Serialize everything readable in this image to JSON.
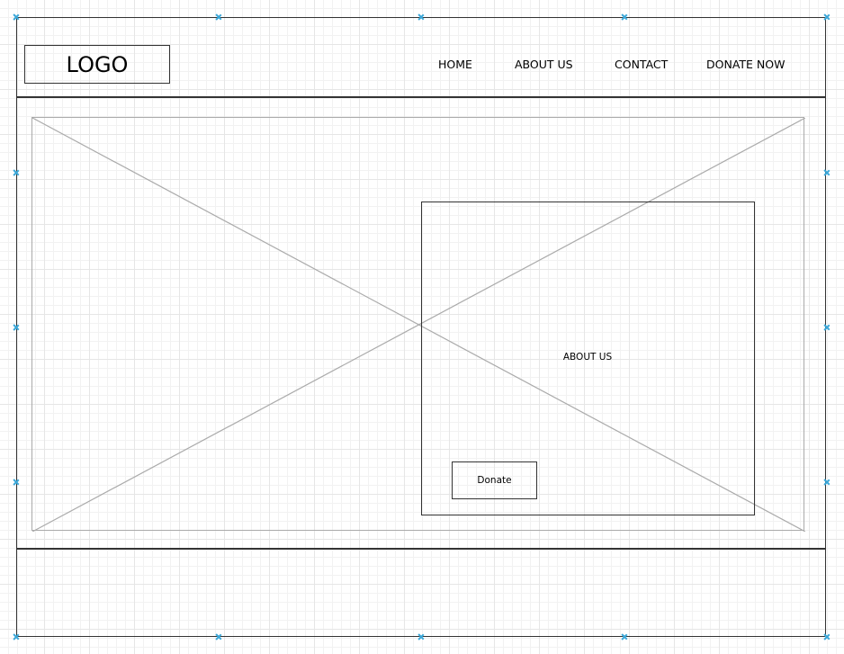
{
  "header": {
    "logo_text": "LOGO",
    "nav": [
      {
        "label": "HOME"
      },
      {
        "label": "ABOUT US"
      },
      {
        "label": "CONTACT"
      },
      {
        "label": "DONATE NOW"
      }
    ]
  },
  "hero": {
    "image_placeholder": "image-placeholder-icon",
    "about_panel": {
      "title": "ABOUT US",
      "button_label": "Donate"
    }
  },
  "colors": {
    "sketch_line": "#333333",
    "placeholder_line": "#aaaaaa",
    "selection_handle": "#29a8e0",
    "grid": "#e6e6e6"
  }
}
